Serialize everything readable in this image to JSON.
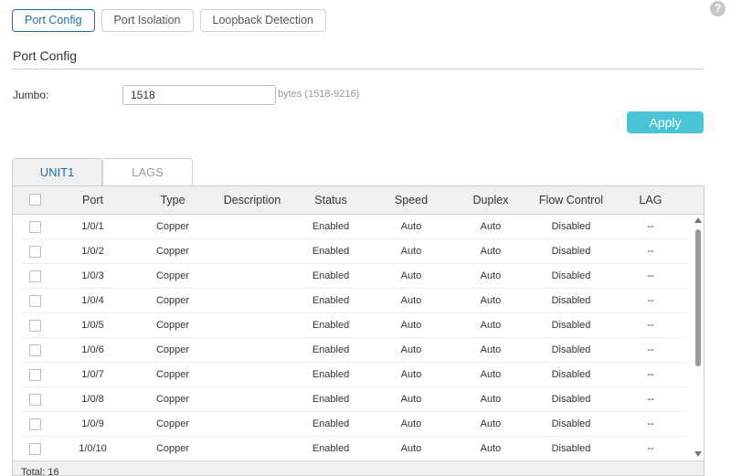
{
  "top_tabs": [
    {
      "label": "Port Config",
      "active": true
    },
    {
      "label": "Port Isolation",
      "active": false
    },
    {
      "label": "Loopback Detection",
      "active": false
    }
  ],
  "help_icon": "?",
  "section_title": "Port Config",
  "jumbo": {
    "label": "Jumbo:",
    "value": "1518",
    "hint": "bytes (1518-9216)"
  },
  "apply_label": "Apply",
  "unit_tabs": [
    {
      "label": "UNIT1",
      "active": true
    },
    {
      "label": "LAGS",
      "active": false
    }
  ],
  "table": {
    "columns": [
      "Port",
      "Type",
      "Description",
      "Status",
      "Speed",
      "Duplex",
      "Flow Control",
      "LAG"
    ],
    "rows": [
      [
        "1/0/1",
        "Copper",
        "",
        "Enabled",
        "Auto",
        "Auto",
        "Disabled",
        "--"
      ],
      [
        "1/0/2",
        "Copper",
        "",
        "Enabled",
        "Auto",
        "Auto",
        "Disabled",
        "--"
      ],
      [
        "1/0/3",
        "Copper",
        "",
        "Enabled",
        "Auto",
        "Auto",
        "Disabled",
        "--"
      ],
      [
        "1/0/4",
        "Copper",
        "",
        "Enabled",
        "Auto",
        "Auto",
        "Disabled",
        "--"
      ],
      [
        "1/0/5",
        "Copper",
        "",
        "Enabled",
        "Auto",
        "Auto",
        "Disabled",
        "--"
      ],
      [
        "1/0/6",
        "Copper",
        "",
        "Enabled",
        "Auto",
        "Auto",
        "Disabled",
        "--"
      ],
      [
        "1/0/7",
        "Copper",
        "",
        "Enabled",
        "Auto",
        "Auto",
        "Disabled",
        "--"
      ],
      [
        "1/0/8",
        "Copper",
        "",
        "Enabled",
        "Auto",
        "Auto",
        "Disabled",
        "--"
      ],
      [
        "1/0/9",
        "Copper",
        "",
        "Enabled",
        "Auto",
        "Auto",
        "Disabled",
        "--"
      ],
      [
        "1/0/10",
        "Copper",
        "",
        "Enabled",
        "Auto",
        "Auto",
        "Disabled",
        "--"
      ]
    ],
    "total": "Total: 16"
  },
  "colors": {
    "accent": "#1f6ea3",
    "apply_button": "#4ac3d6",
    "header_bg": "#eef0f2"
  }
}
